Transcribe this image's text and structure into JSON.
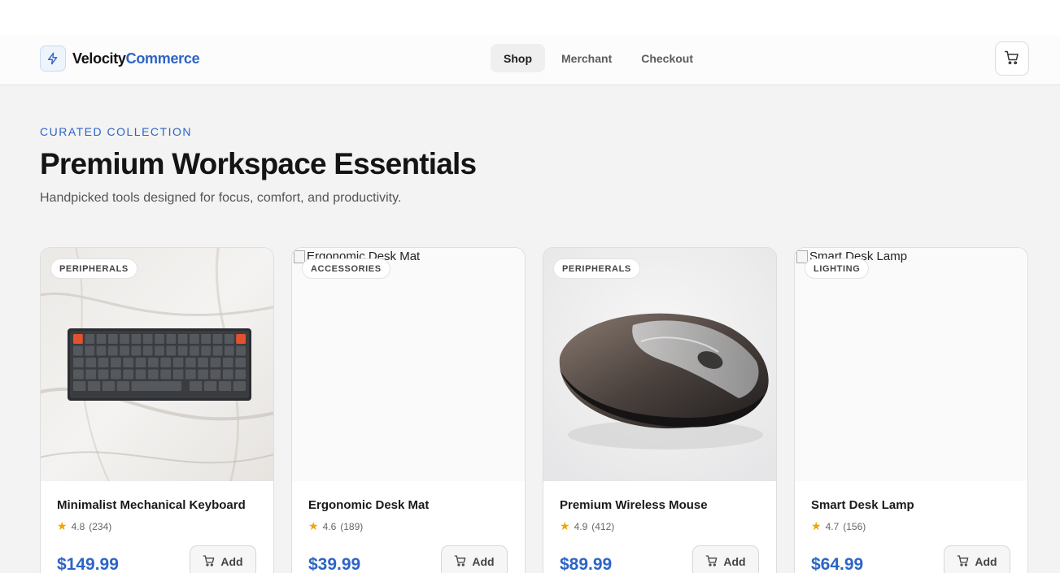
{
  "brand": {
    "name_part1": "Velocity",
    "name_part2": "Commerce",
    "icon": "lightning-icon"
  },
  "nav": [
    {
      "label": "Shop",
      "active": true
    },
    {
      "label": "Merchant",
      "active": false
    },
    {
      "label": "Checkout",
      "active": false
    }
  ],
  "header": {
    "cart_icon": "cart-icon"
  },
  "hero": {
    "eyebrow": "CURATED COLLECTION",
    "title": "Premium Workspace Essentials",
    "subtitle": "Handpicked tools designed for focus, comfort, and productivity."
  },
  "products": [
    {
      "category": "PERIPHERALS",
      "name": "Minimalist Mechanical Keyboard",
      "rating": "4.8",
      "reviews": "(234)",
      "price": "$149.99",
      "add_label": "Add",
      "image_alt": "",
      "image": "keyboard"
    },
    {
      "category": "ACCESSORIES",
      "name": "Ergonomic Desk Mat",
      "rating": "4.6",
      "reviews": "(189)",
      "price": "$39.99",
      "add_label": "Add",
      "image_alt": "Ergonomic Desk Mat",
      "image": "broken"
    },
    {
      "category": "PERIPHERALS",
      "name": "Premium Wireless Mouse",
      "rating": "4.9",
      "reviews": "(412)",
      "price": "$89.99",
      "add_label": "Add",
      "image_alt": "",
      "image": "mouse"
    },
    {
      "category": "LIGHTING",
      "name": "Smart Desk Lamp",
      "rating": "4.7",
      "reviews": "(156)",
      "price": "$64.99",
      "add_label": "Add",
      "image_alt": "Smart Desk Lamp",
      "image": "broken"
    }
  ],
  "colors": {
    "accent": "#2c64c6",
    "star": "#f0a500",
    "background": "#f3f3f3"
  }
}
